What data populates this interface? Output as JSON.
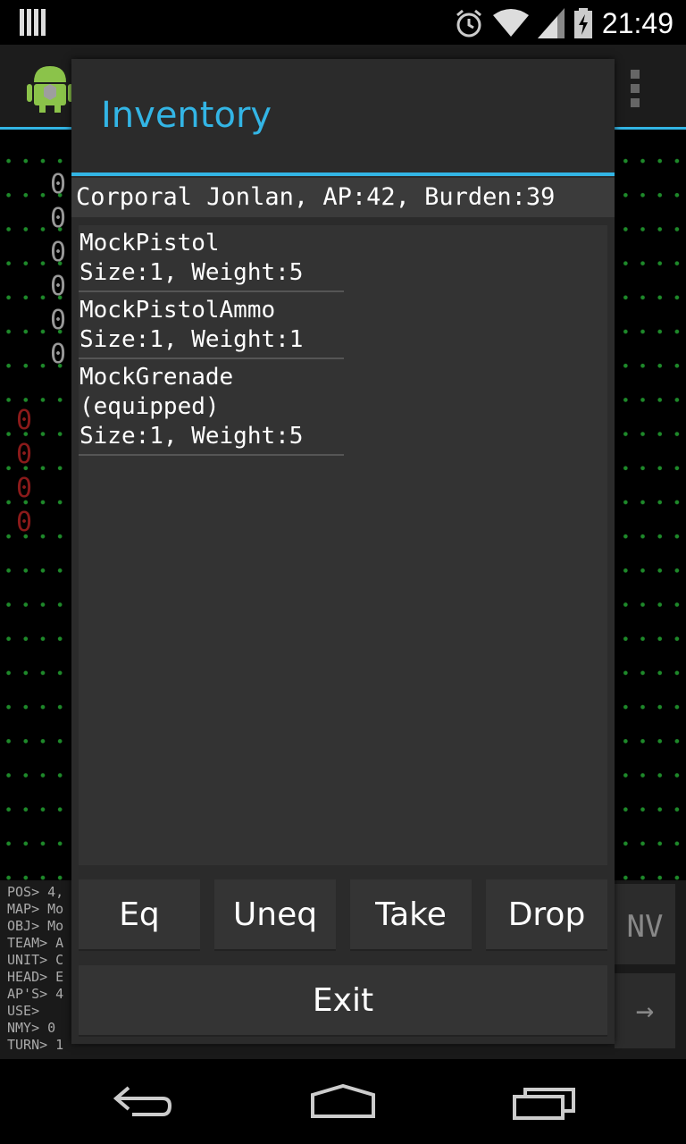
{
  "status_bar": {
    "time": "21:49"
  },
  "dialog": {
    "title": "Inventory",
    "character_header": "Corporal Jonlan, AP:42, Burden:39",
    "items": [
      {
        "name": "MockPistol",
        "status": "",
        "stats": "Size:1, Weight:5"
      },
      {
        "name": "MockPistolAmmo",
        "status": "",
        "stats": "Size:1, Weight:1"
      },
      {
        "name": "MockGrenade",
        "status": "(equipped)",
        "stats": "Size:1, Weight:5"
      }
    ],
    "buttons": {
      "equip": "Eq",
      "unequip": "Uneq",
      "take": "Take",
      "drop": "Drop",
      "exit": "Exit"
    }
  },
  "background": {
    "info_lines": [
      "POS> 4,",
      "MAP> Mo",
      "OBJ> Mo",
      "TEAM> A",
      "UNIT> C",
      "HEAD> E",
      "AP'S> 4",
      "USE>",
      "NMY> 0",
      "TURN> 1"
    ],
    "right_button_label": "NV",
    "right_arrow": "→",
    "grid_chars_green": [
      "0",
      "0",
      "0",
      "0",
      "0",
      "0"
    ],
    "grid_chars_red": [
      "0",
      "0",
      "0",
      "0"
    ]
  },
  "colors": {
    "accent": "#33b5e5",
    "dialog_bg": "#2b2b2b",
    "list_bg": "#333333",
    "grid_dot": "#1e8a2a",
    "enemy_red": "#8b1a1a"
  },
  "icons": {
    "back": "back-icon",
    "home": "home-icon",
    "recents": "recent-apps-icon",
    "alarm": "alarm-icon",
    "wifi": "wifi-icon",
    "signal": "signal-icon",
    "battery": "battery-charging-icon"
  }
}
